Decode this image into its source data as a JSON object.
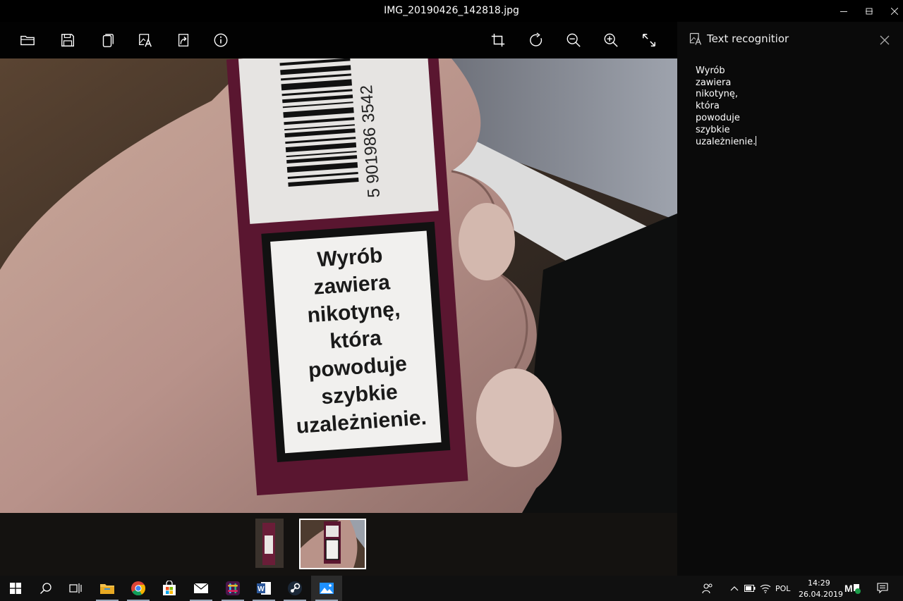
{
  "window": {
    "title": "IMG_20190426_142818.jpg",
    "minimize_glyph": "—",
    "maximize_glyph": "☐",
    "close_glyph": "✕"
  },
  "toolbar": {
    "left_icons": [
      "open-folder-icon",
      "save-icon",
      "copy-icon",
      "text-recognition-icon",
      "share-icon",
      "info-icon"
    ],
    "right_icons": [
      "crop-icon",
      "rotate-icon",
      "zoom-out-icon",
      "zoom-in-icon",
      "fullscreen-icon"
    ]
  },
  "photo": {
    "warning_lines": [
      "Wyrób",
      "zawiera",
      "nikotynę,",
      "która",
      "powoduje",
      "szybkie",
      "uzależnienie."
    ],
    "barcode_text": "5 901986 3542"
  },
  "panel": {
    "title": "Text recognitior",
    "recognized_lines": [
      "Wyrób",
      "zawiera",
      "nikotynę,",
      "która",
      "powoduje",
      "szybkie",
      "uzależnienie."
    ]
  },
  "taskbar": {
    "apps": [
      "start-icon",
      "search-icon",
      "task-view-icon",
      "file-explorer-icon",
      "chrome-icon",
      "store-icon",
      "mail-icon",
      "slack-icon",
      "word-icon",
      "steam-icon",
      "photos-icon"
    ],
    "language": "POL",
    "time": "14:29",
    "date": "26.04.2019"
  },
  "colors": {
    "panel_bg": "#0a0a0a",
    "taskbar_bg": "#101010",
    "accent_blue": "#0078d7"
  }
}
